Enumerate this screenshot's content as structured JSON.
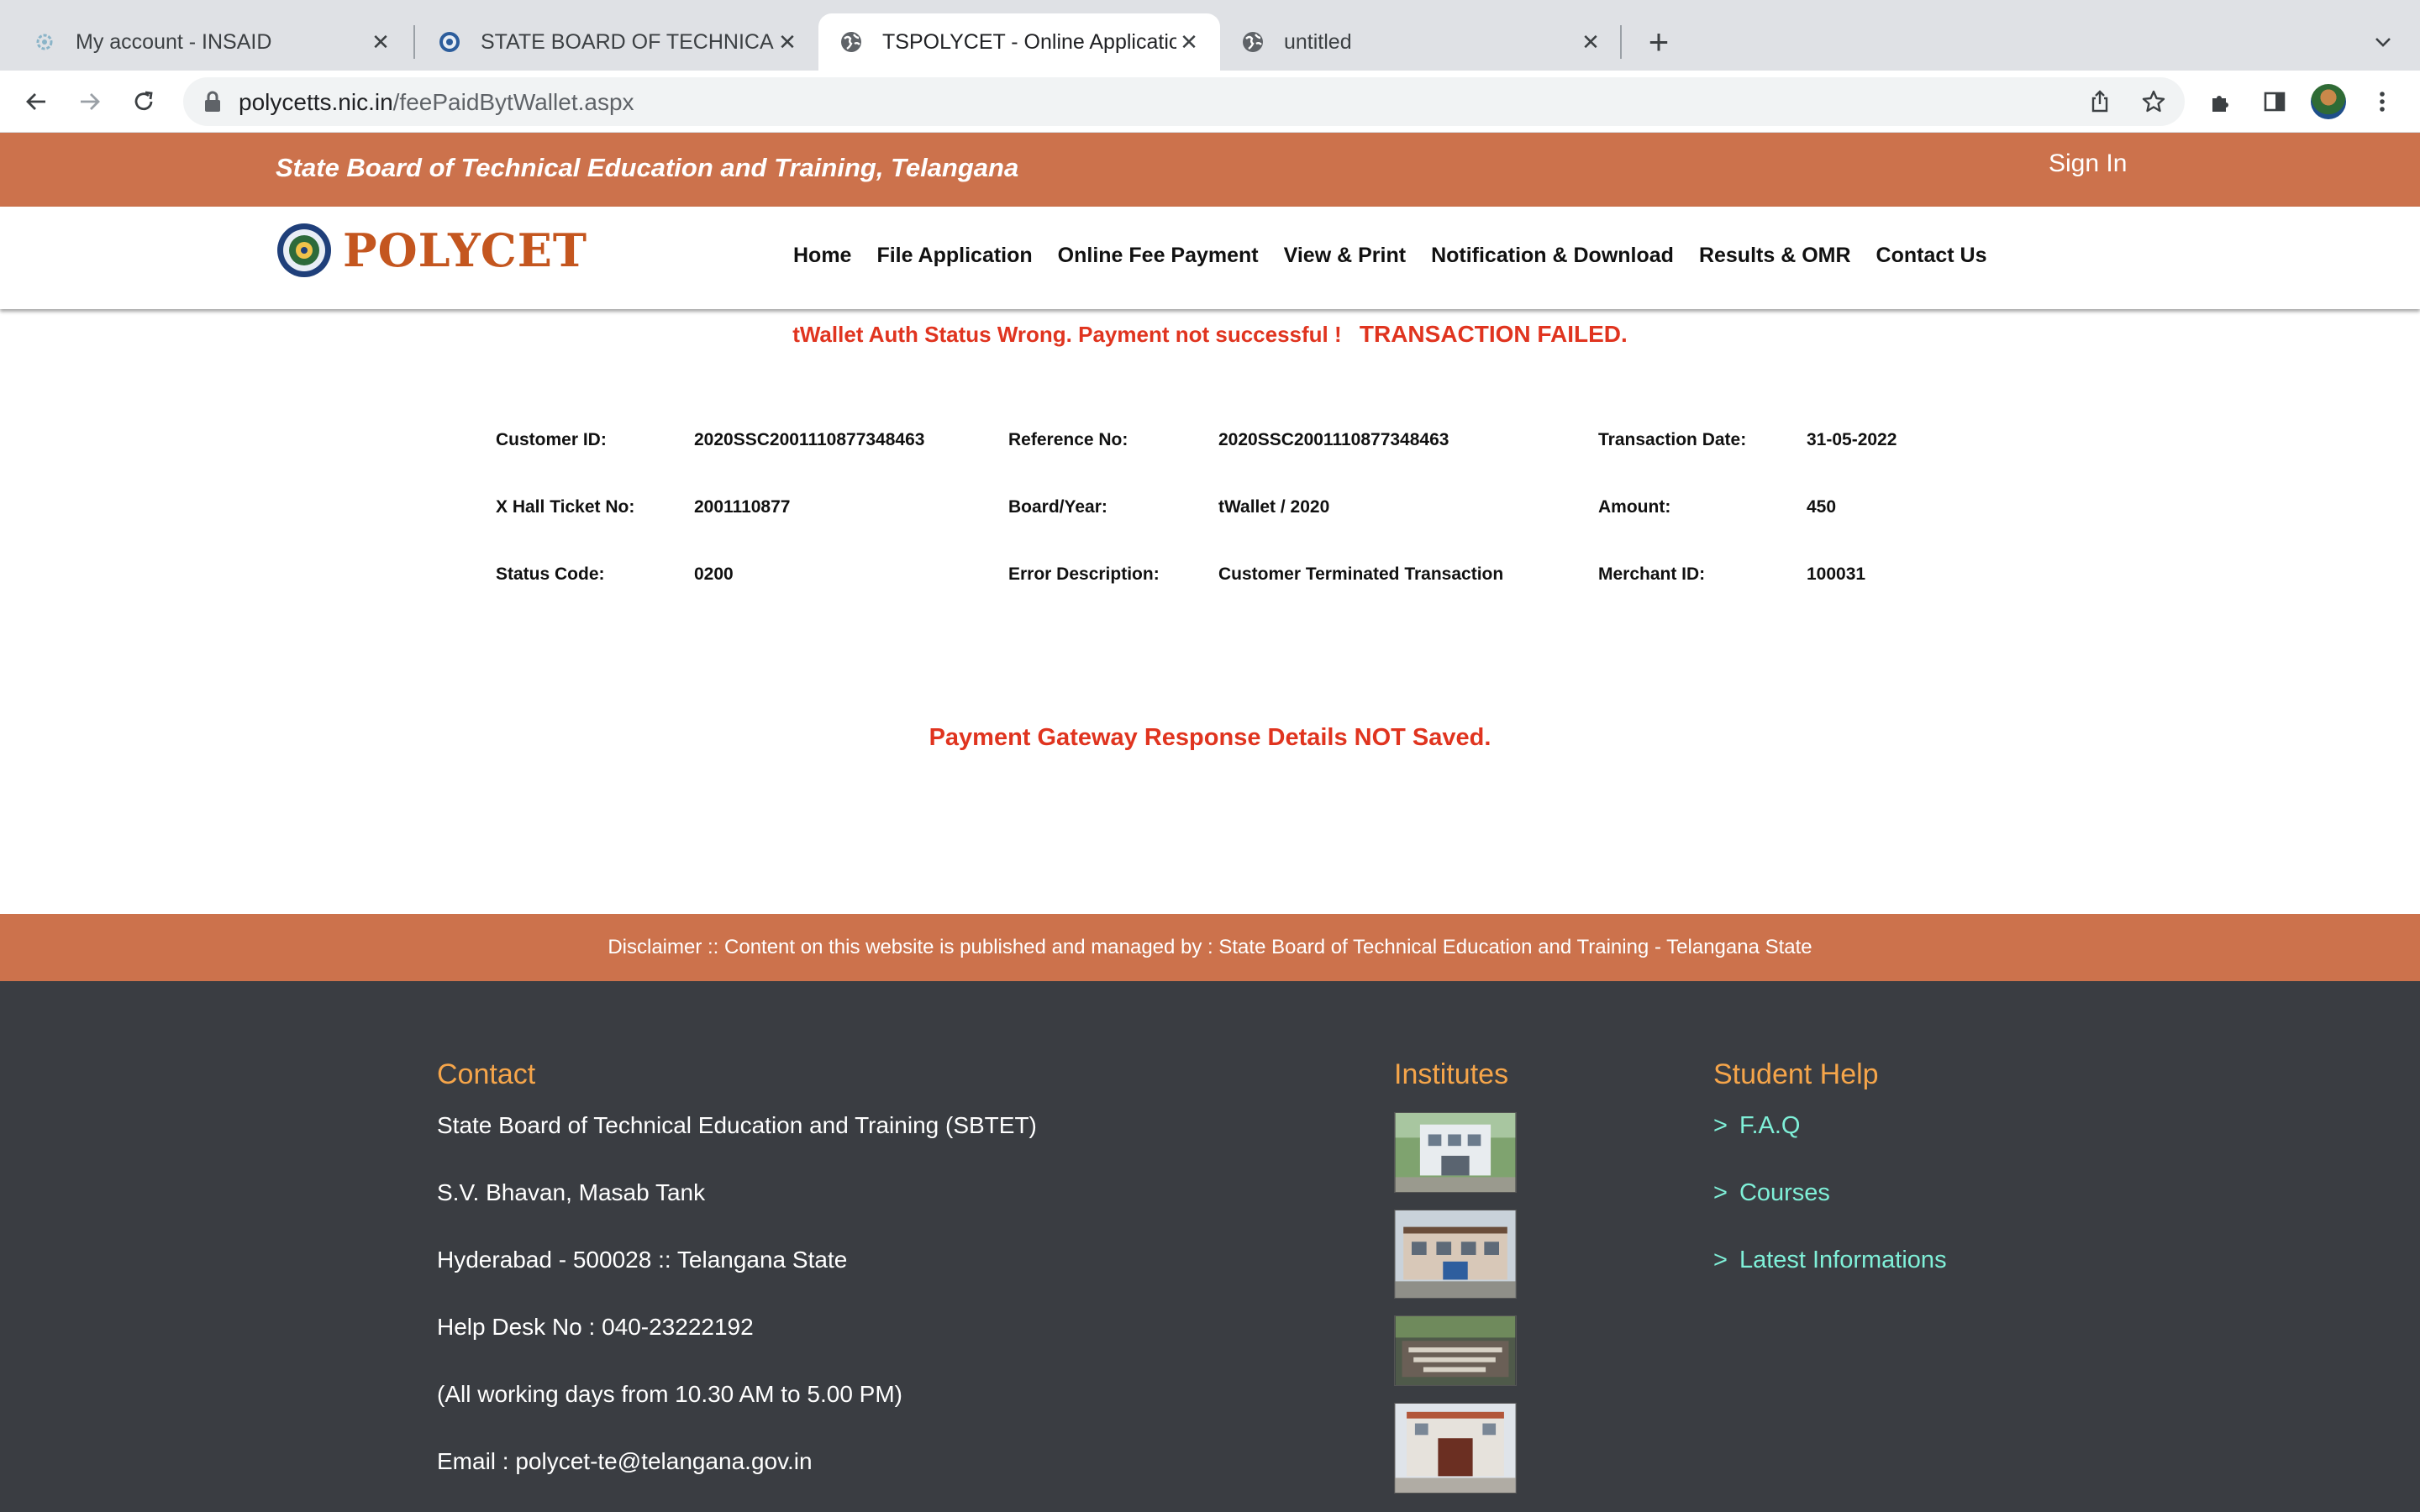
{
  "browser": {
    "tabs": [
      {
        "title": "My account - INSAID",
        "icon": "gear-favicon",
        "active": false
      },
      {
        "title": "STATE BOARD OF TECHNICAL",
        "icon": "seal-favicon",
        "active": false
      },
      {
        "title": "TSPOLYCET - Online Applicatio",
        "icon": "globe-favicon",
        "active": true
      },
      {
        "title": "untitled",
        "icon": "globe-favicon",
        "active": false
      }
    ],
    "url_host": "polycetts.nic.in",
    "url_path": "/feePaidBytWallet.aspx"
  },
  "site": {
    "board_title": "State Board of Technical Education and Training, Telangana",
    "sign_in": "Sign In",
    "brand": "POLYCET",
    "nav": [
      "Home",
      "File Application",
      "Online Fee Payment",
      "View & Print",
      "Notification & Download",
      "Results & OMR",
      "Contact Us"
    ]
  },
  "status": {
    "message": "tWallet Auth Status Wrong. Payment not successful !",
    "failed": "TRANSACTION FAILED.",
    "color": "#e0341f"
  },
  "details": {
    "rows": [
      [
        {
          "label": "Customer ID:",
          "value": "2020SSC2001110877348463"
        },
        {
          "label": "Reference No:",
          "value": "2020SSC2001110877348463"
        },
        {
          "label": "Transaction Date:",
          "value": "31-05-2022"
        }
      ],
      [
        {
          "label": "X Hall Ticket No:",
          "value": "2001110877"
        },
        {
          "label": "Board/Year:",
          "value": "tWallet / 2020"
        },
        {
          "label": "Amount:",
          "value": "450"
        }
      ],
      [
        {
          "label": "Status Code:",
          "value": "0200"
        },
        {
          "label": "Error Description:",
          "value": "Customer Terminated Transaction"
        },
        {
          "label": "Merchant ID:",
          "value": "100031"
        }
      ]
    ]
  },
  "gateway_message": "Payment Gateway Response Details NOT Saved.",
  "footer": {
    "disclaimer": "Disclaimer :: Content on this website is published and managed by : State Board of Technical Education and Training - Telangana State",
    "contact_heading": "Contact",
    "contact_lines": [
      "State Board of Technical Education and Training (SBTET)",
      "S.V. Bhavan, Masab Tank",
      "Hyderabad - 500028 :: Telangana State",
      "Help Desk No : 040-23222192",
      "(All working days from 10.30 AM to 5.00 PM)",
      "Email : polycet-te@telangana.gov.in"
    ],
    "institutes_heading": "Institutes",
    "student_help_heading": "Student Help",
    "help_links": [
      "F.A.Q",
      "Courses",
      "Latest Informations"
    ],
    "colors": {
      "band": "#cc724c",
      "footer_bg": "#3a3d42",
      "heading": "#f5a54a",
      "link": "#7ff0d8"
    }
  }
}
